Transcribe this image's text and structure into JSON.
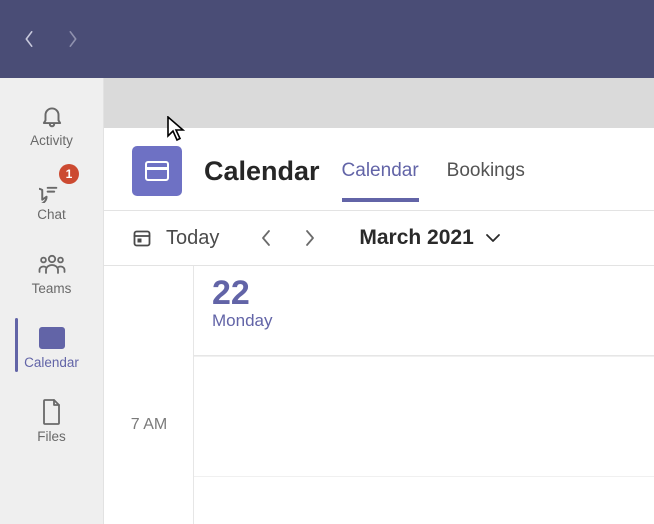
{
  "rail": {
    "activity": {
      "label": "Activity"
    },
    "chat": {
      "label": "Chat",
      "badge": "1"
    },
    "teams": {
      "label": "Teams"
    },
    "calendar": {
      "label": "Calendar"
    },
    "files": {
      "label": "Files"
    }
  },
  "header": {
    "title": "Calendar",
    "tabs": {
      "calendar": {
        "label": "Calendar"
      },
      "bookings": {
        "label": "Bookings"
      }
    }
  },
  "cmdbar": {
    "today": "Today",
    "period": "March 2021"
  },
  "day": {
    "date": "22",
    "name": "Monday"
  },
  "hours": {
    "h7": "7 AM"
  }
}
